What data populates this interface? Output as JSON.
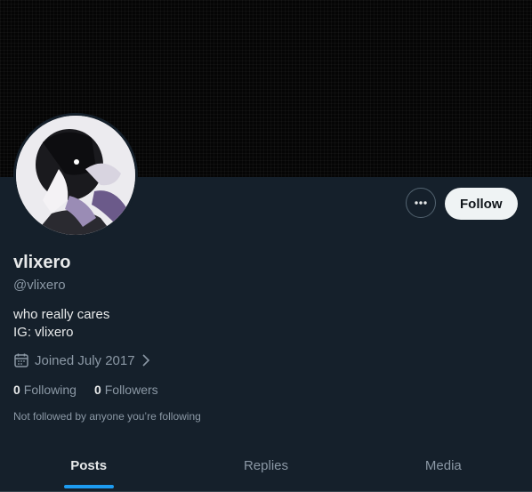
{
  "profile": {
    "display_name": "vlixero",
    "handle": "@vlixero",
    "bio_line1": "who really cares",
    "bio_line2": "IG: vlixero",
    "joined": "Joined July 2017",
    "following_count": "0",
    "following_label": "Following",
    "followers_count": "0",
    "followers_label": "Followers",
    "not_followed_note": "Not followed by anyone you’re following"
  },
  "actions": {
    "follow_label": "Follow",
    "more_icon": "more-horizontal-icon"
  },
  "tabs": [
    {
      "label": "Posts",
      "active": true
    },
    {
      "label": "Replies",
      "active": false
    },
    {
      "label": "Media",
      "active": false
    }
  ],
  "colors": {
    "background": "#15202b",
    "accent": "#1d9bf0",
    "text_primary": "#e7e9ea",
    "text_secondary": "#8b98a5",
    "follow_button_bg": "#eff3f4"
  }
}
